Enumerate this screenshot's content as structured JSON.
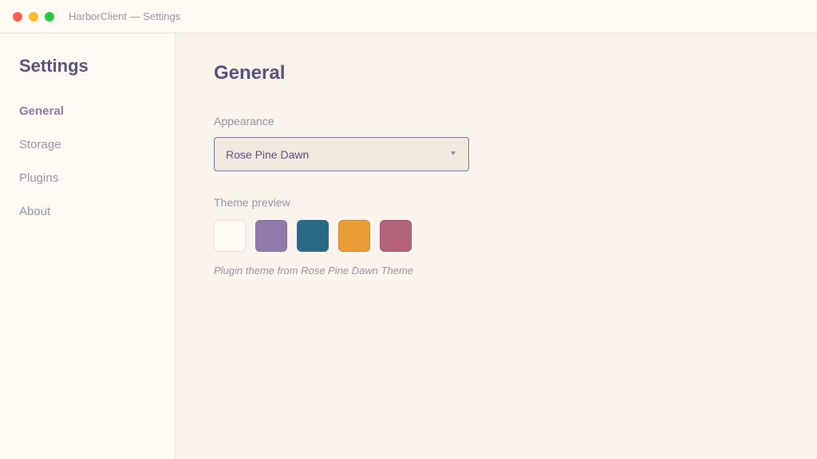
{
  "window": {
    "title": "HarborClient — Settings"
  },
  "sidebar": {
    "title": "Settings",
    "items": [
      {
        "label": "General",
        "active": true
      },
      {
        "label": "Storage",
        "active": false
      },
      {
        "label": "Plugins",
        "active": false
      },
      {
        "label": "About",
        "active": false
      }
    ]
  },
  "main": {
    "title": "General",
    "appearance": {
      "label": "Appearance",
      "selected": "Rose Pine Dawn"
    },
    "preview": {
      "label": "Theme preview",
      "swatches": [
        "#fffaf3",
        "#907aa9",
        "#286983",
        "#ea9d34",
        "#b4637a"
      ],
      "caption": "Plugin theme from Rose Pine Dawn Theme"
    }
  },
  "colors": {
    "background": "#faf4ed",
    "surface": "#fffaf3",
    "text": "#575279",
    "muted": "#9893a5",
    "accent": "#907aa9"
  }
}
